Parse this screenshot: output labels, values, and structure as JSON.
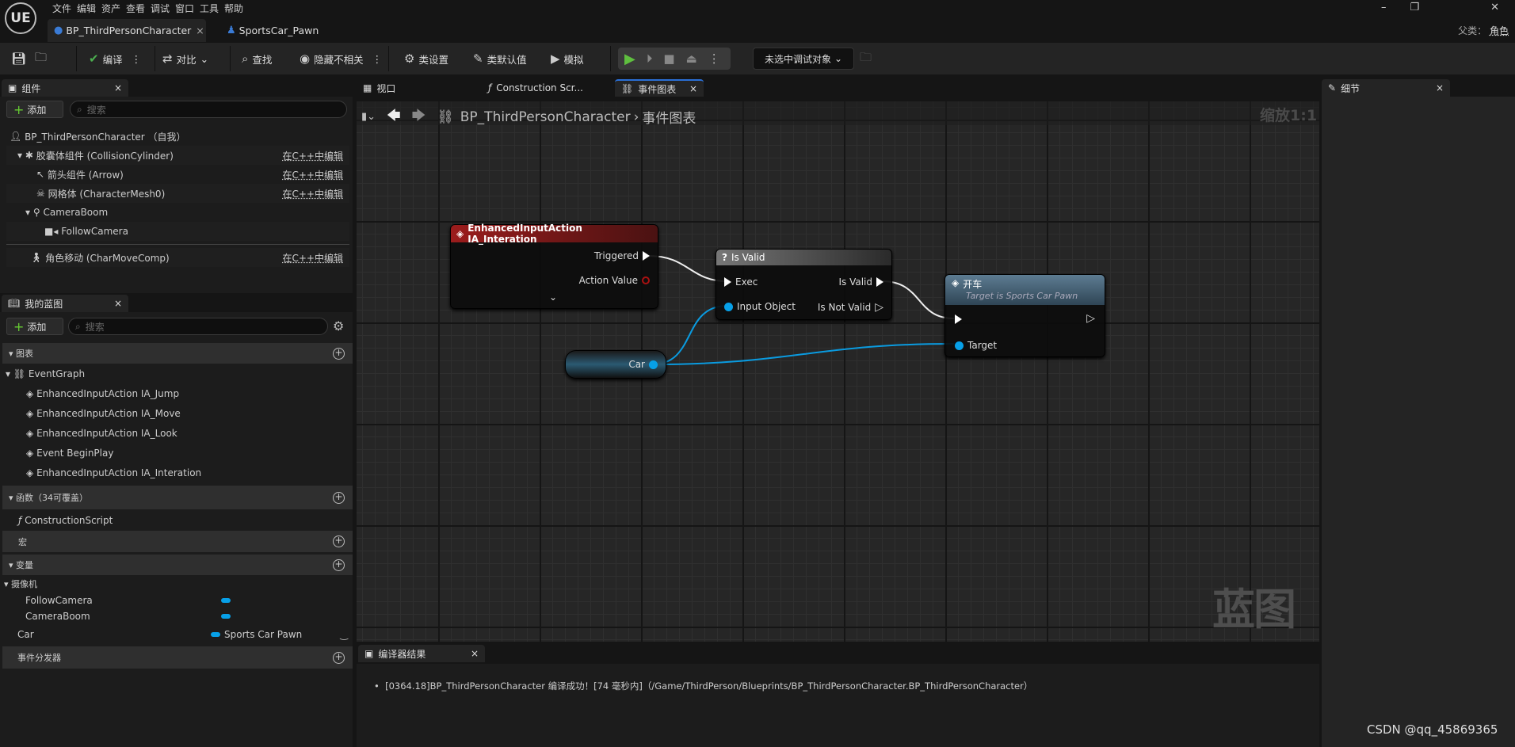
{
  "app": {
    "logo": "UE",
    "menu": [
      "文件",
      "编辑",
      "资产",
      "查看",
      "调试",
      "窗口",
      "工具",
      "帮助"
    ],
    "doc_tabs": [
      {
        "label": "BP_ThirdPersonCharacter",
        "icon": "character-icon",
        "active": true
      },
      {
        "label": "SportsCar_Pawn",
        "icon": "pawn-icon",
        "active": false
      }
    ],
    "parent_class_label": "父类：",
    "parent_class": "角色"
  },
  "toolbar": {
    "compile": "编译",
    "diff": "对比",
    "find": "查找",
    "hide_unrelated": "隐藏不相关",
    "class_settings": "类设置",
    "class_defaults": "类默认值",
    "simulate": "模拟",
    "debug_target": "未选中调试对象"
  },
  "components": {
    "tab": "组件",
    "add": "添加",
    "search_placeholder": "搜索",
    "edit_cpp": "在C++中编辑",
    "items": [
      {
        "label": "BP_ThirdPersonCharacter （自我）"
      },
      {
        "label": "胶囊体组件 (CollisionCylinder)"
      },
      {
        "label": "箭头组件 (Arrow)"
      },
      {
        "label": "网格体 (CharacterMesh0)"
      },
      {
        "label": "CameraBoom"
      },
      {
        "label": "FollowCamera"
      },
      {
        "label": "角色移动 (CharMoveComp)"
      }
    ]
  },
  "my_blueprint": {
    "tab": "我的蓝图",
    "add": "添加",
    "search_placeholder": "搜索",
    "graphs_header": "图表",
    "event_graph": "EventGraph",
    "events": [
      "EnhancedInputAction IA_Jump",
      "EnhancedInputAction IA_Move",
      "EnhancedInputAction IA_Look",
      "Event BeginPlay",
      "EnhancedInputAction IA_Interation"
    ],
    "functions_header": "函数（34可覆盖）",
    "functions": [
      "ConstructionScript"
    ],
    "macros_header": "宏",
    "variables_header": "变量",
    "var_category": "摄像机",
    "variables": [
      {
        "name": "FollowCamera",
        "type": ""
      },
      {
        "name": "CameraBoom",
        "type": ""
      },
      {
        "name": "Car",
        "type": "Sports Car Pawn"
      }
    ],
    "dispatchers_header": "事件分发器",
    "var_color": "#07a0e8"
  },
  "editor_tabs": [
    {
      "label": "视口"
    },
    {
      "label": "Construction Scr..."
    },
    {
      "label": "事件图表",
      "active": true
    }
  ],
  "breadcrumb": {
    "root": "BP_ThirdPersonCharacter",
    "current": "事件图表"
  },
  "graph": {
    "zoom": "缩放1:1",
    "watermark": "蓝图",
    "nodes": {
      "input_action": {
        "title": "EnhancedInputAction IA_Interation",
        "pins": {
          "triggered": "Triggered",
          "action_value": "Action Value"
        },
        "color": "#8a1a1a"
      },
      "is_valid": {
        "title": "Is Valid",
        "pins": {
          "exec": "Exec",
          "input_object": "Input Object",
          "is_valid": "Is Valid",
          "is_not_valid": "Is Not Valid"
        }
      },
      "drive": {
        "title": "开车",
        "subtitle": "Target is Sports Car Pawn",
        "pins": {
          "target": "Target"
        }
      },
      "car_getter": {
        "label": "Car"
      }
    }
  },
  "details": {
    "tab": "细节"
  },
  "compiler": {
    "tab": "编译器结果",
    "message": "[0364.18]BP_ThirdPersonCharacter 编译成功！[74 毫秒内]（/Game/ThirdPerson/Blueprints/BP_ThirdPersonCharacter.BP_ThirdPersonCharacter）"
  },
  "watermark": "CSDN @qq_45869365"
}
